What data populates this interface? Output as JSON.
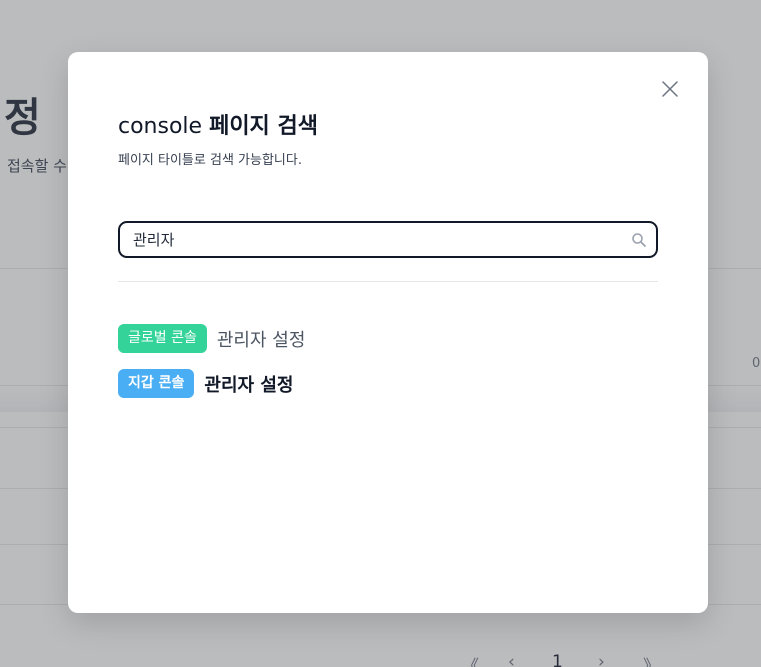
{
  "background": {
    "page_title_fragment": "정",
    "page_subtitle_fragment": "접속할 수",
    "cell_fragment": "0",
    "pager": {
      "first": "《",
      "prev": "‹",
      "current_page": "1",
      "next": "›",
      "last": "》"
    }
  },
  "modal": {
    "title_prefix": "console",
    "title_main": "페이지 검색",
    "description": "페이지 타이틀로 검색 가능합니다.",
    "search": {
      "value": "관리자",
      "icon": "search-icon"
    },
    "close_icon": "close-icon",
    "results": [
      {
        "badge": "글로벌 콘솔",
        "badge_color": "#34d399",
        "label": "관리자 설정"
      },
      {
        "badge": "지갑 콘솔",
        "badge_color": "#4aaef5",
        "label": "관리자 설정"
      }
    ]
  }
}
